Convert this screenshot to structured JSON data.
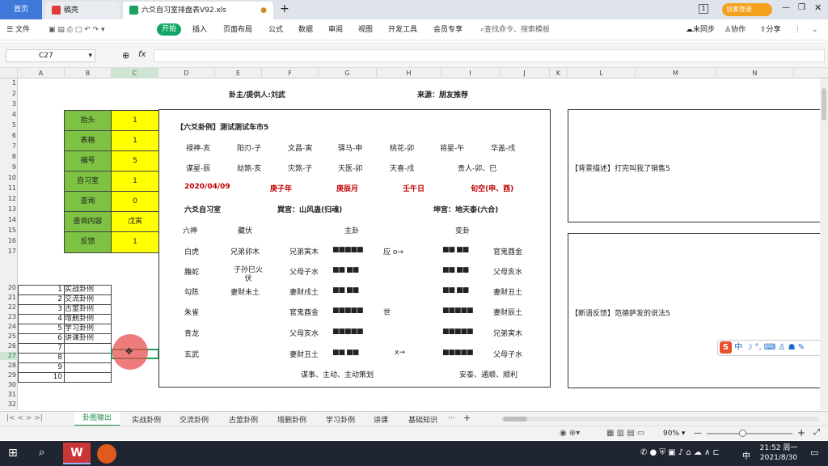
{
  "tabs": {
    "home": "首页",
    "draw": "稿壳",
    "file": "六爻自习室排盘表V92.xls"
  },
  "titlebar": {
    "login": "访客登录",
    "badge": "1"
  },
  "menu": {
    "file": "文件",
    "start": "开始",
    "insert": "插入",
    "layout": "页面布局",
    "formula": "公式",
    "data": "数据",
    "review": "审阅",
    "view": "视图",
    "dev": "开发工具",
    "member": "会员专享",
    "search": "查找命令、搜索模板",
    "sync": "未同步",
    "collab": "协作",
    "share": "分享"
  },
  "formula": {
    "cellref": "C27",
    "fx": "fx"
  },
  "columns": [
    "A",
    "B",
    "C",
    "D",
    "E",
    "F",
    "G",
    "H",
    "I",
    "J",
    "K",
    "L",
    "M",
    "N"
  ],
  "rows": [
    "1",
    "2",
    "3",
    "4",
    "5",
    "6",
    "7",
    "8",
    "9",
    "10",
    "11",
    "12",
    "13",
    "14",
    "15",
    "16",
    "17",
    "20",
    "21",
    "22",
    "23",
    "24",
    "25",
    "26",
    "27",
    "28",
    "29",
    "30",
    "31",
    "32"
  ],
  "header": {
    "owner": "卦主/提供人:刘武",
    "source": "来源：朋友推荐"
  },
  "params": [
    {
      "label": "抬头",
      "value": "1"
    },
    {
      "label": "表格",
      "value": "1"
    },
    {
      "label": "编号",
      "value": "5"
    },
    {
      "label": "自习室",
      "value": "1"
    },
    {
      "label": "查询",
      "value": "0"
    },
    {
      "label": "查询内容",
      "value": "戊寅"
    },
    {
      "label": "反馈",
      "value": "1"
    }
  ],
  "cases": [
    {
      "n": "1",
      "name": "实战卦例"
    },
    {
      "n": "2",
      "name": "交流卦例"
    },
    {
      "n": "3",
      "name": "古筮卦例"
    },
    {
      "n": "4",
      "name": "增删卦例"
    },
    {
      "n": "5",
      "name": "学习卦例"
    },
    {
      "n": "6",
      "name": "讲课卦例"
    },
    {
      "n": "7",
      "name": ""
    },
    {
      "n": "8",
      "name": ""
    },
    {
      "n": "9",
      "name": ""
    },
    {
      "n": "10",
      "name": ""
    }
  ],
  "gua": {
    "title": "【六爻卦例】测试测试车市5",
    "shensha1": [
      "禄神-亥",
      "阳刃-子",
      "文昌-寅",
      "驿马-申",
      "桃花-卯",
      "将星-午",
      "华盖-戌"
    ],
    "shensha2": [
      "谋星-辰",
      "劫煞-亥",
      "灾煞-子",
      "天医-卯",
      "天喜-戌",
      "贵人-卯、巳"
    ],
    "dates": [
      "2020/04/09",
      "庚子年",
      "庚辰月",
      "壬午日",
      "旬空(申、酉)"
    ],
    "room": "六爻自习室",
    "main": "巽宫：山风蛊(归魂)",
    "change": "坤宫：地天泰(六合)",
    "heads": [
      "六神",
      "藏伏",
      "主卦",
      "变卦"
    ],
    "lines": [
      {
        "god": "白虎",
        "hidden": "兄弟卯木",
        "yao": "兄弟寅木",
        "bar": "■■■■■",
        "mark": "应 o→",
        "cbar": "■■ ■■",
        "cyao": "官鬼酉金"
      },
      {
        "god": "螣蛇",
        "hidden": "子孙巳火伏",
        "yao": "父母子水",
        "bar": "■■ ■■",
        "mark": "",
        "cbar": "■■ ■■",
        "cyao": "父母亥水"
      },
      {
        "god": "勾陈",
        "hidden": "妻财未土",
        "yao": "妻财戌土",
        "bar": "■■ ■■",
        "mark": "",
        "cbar": "■■ ■■",
        "cyao": "妻财丑土"
      },
      {
        "god": "朱雀",
        "hidden": "",
        "yao": "官鬼酉金",
        "bar": "■■■■■",
        "mark": "世",
        "cbar": "■■■■■",
        "cyao": "妻财辰土"
      },
      {
        "god": "青龙",
        "hidden": "",
        "yao": "父母亥水",
        "bar": "■■■■■",
        "mark": "",
        "cbar": "■■■■■",
        "cyao": "兄弟寅木"
      },
      {
        "god": "玄武",
        "hidden": "",
        "yao": "妻财丑土",
        "bar": "■■ ■■",
        "mark": "x→",
        "cbar": "■■■■■",
        "cyao": "父母子水"
      }
    ],
    "foot1": "谋事、主动、主动策划",
    "foot2": "安泰、通顺、顺利"
  },
  "notes": {
    "bg": "【背景描述】打完叫我了销售5",
    "fb": "【断语反馈】范德萨发的说法5"
  },
  "sheets": [
    "卦图输出",
    "实战卦例",
    "交流卦例",
    "古筮卦例",
    "增删卦例",
    "学习卦例",
    "讲课",
    "基础知识"
  ],
  "status": {
    "zoom": "90%"
  },
  "clock": {
    "time": "21:52 周一",
    "date": "2021/8/30",
    "ime": "中"
  }
}
